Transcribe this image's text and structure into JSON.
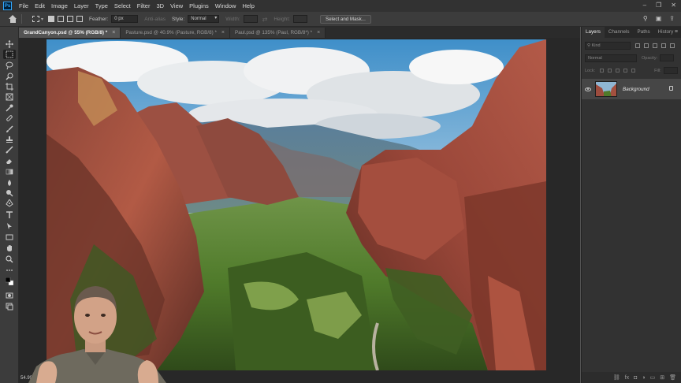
{
  "app": {
    "logo": "Ps"
  },
  "menu": [
    "File",
    "Edit",
    "Image",
    "Layer",
    "Type",
    "Select",
    "Filter",
    "3D",
    "View",
    "Plugins",
    "Window",
    "Help"
  ],
  "window_controls": {
    "minimize": "–",
    "restore": "❐",
    "close": "✕"
  },
  "options_bar": {
    "feather_label": "Feather:",
    "feather_value": "0 px",
    "anti_alias_label": "Anti-alias",
    "style_label": "Style:",
    "style_value": "Normal",
    "width_label": "Width:",
    "height_label": "Height:",
    "select_mask_label": "Select and Mask..."
  },
  "tabs": [
    {
      "label": "GrandCanyon.psd @ 55% (RGB/8) *",
      "close": "×",
      "active": true
    },
    {
      "label": "Pasture.psd @ 40.9% (Pasture, RGB/8) *",
      "close": "×",
      "active": false
    },
    {
      "label": "Paul.psd @ 135% (Paul, RGB/8*) *",
      "close": "×",
      "active": false
    }
  ],
  "status": {
    "zoom": "54.99%"
  },
  "panels": {
    "tabs": [
      "Layers",
      "Channels",
      "Paths",
      "History"
    ],
    "menu_icon": "≡",
    "kind_label": "Kind",
    "blend_mode": "Normal",
    "opacity_label": "Opacity:",
    "lock_label": "Lock:",
    "fill_label": "Fill:",
    "layers": [
      {
        "name": "Background",
        "visible": true,
        "locked": true
      }
    ],
    "footer_icons": [
      "link-icon",
      "fx-icon",
      "mask-icon",
      "adjustment-icon",
      "folder-icon",
      "new-layer-icon",
      "trash-icon"
    ],
    "footer_glyphs": [
      "⛓",
      "fx",
      "◘",
      "◑",
      "▭",
      "⊞",
      "🗑"
    ]
  },
  "tools": [
    "move-icon",
    "marquee-icon",
    "lasso-icon",
    "quick-select-icon",
    "crop-icon",
    "frame-icon",
    "eyedropper-icon",
    "healing-icon",
    "brush-icon",
    "stamp-icon",
    "history-brush-icon",
    "eraser-icon",
    "gradient-icon",
    "blur-icon",
    "dodge-icon",
    "pen-icon",
    "type-icon",
    "path-select-icon",
    "rectangle-icon",
    "hand-icon",
    "zoom-icon",
    "more-icon",
    "color-swatch-icon",
    "quick-mask-icon",
    "screen-mode-icon"
  ],
  "colors": {
    "accent": "#31a8ff",
    "chrome": "#3c3c3c",
    "canvas_bg": "#282828"
  }
}
